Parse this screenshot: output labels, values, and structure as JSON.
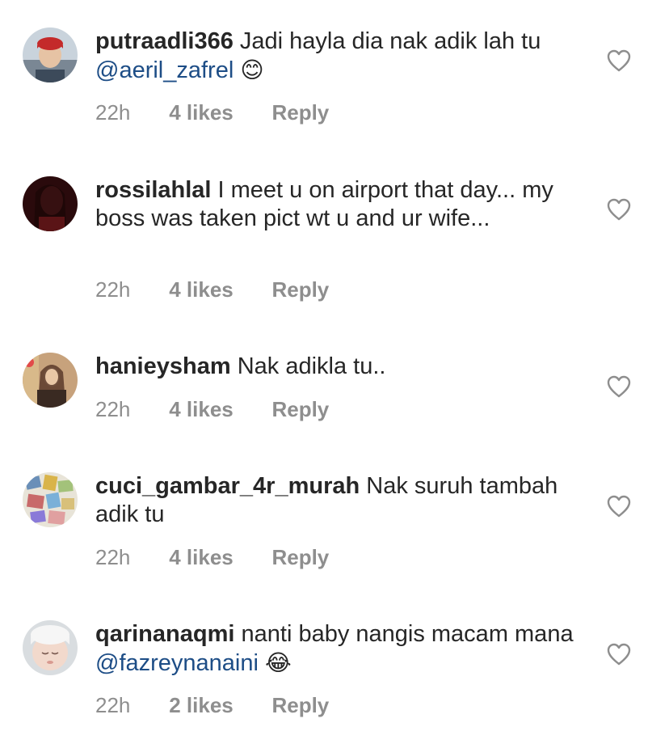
{
  "comments": [
    {
      "username": "putraadli366",
      "text_before": "Jadi hayla dia nak adik lah tu",
      "mention": "@aeril_zafrel",
      "emoji": "😊",
      "time": "22h",
      "likes": "4 likes",
      "reply": "Reply"
    },
    {
      "username": "rossilahlal",
      "text_before": "I meet u on airport that day... my boss was taken pict wt u and ur wife...",
      "mention": "",
      "emoji": "",
      "time": "22h",
      "likes": "4 likes",
      "reply": "Reply"
    },
    {
      "username": "hanieysham",
      "text_before": "Nak adikla tu..",
      "mention": "",
      "emoji": "",
      "time": "22h",
      "likes": "4 likes",
      "reply": "Reply"
    },
    {
      "username": "cuci_gambar_4r_murah",
      "text_before": "Nak suruh tambah adik tu",
      "mention": "",
      "emoji": "",
      "time": "22h",
      "likes": "4 likes",
      "reply": "Reply"
    },
    {
      "username": "qarinanaqmi",
      "text_before": "nanti baby nangis macam mana",
      "mention": "@fazreynanaini",
      "emoji": "😂",
      "time": "22h",
      "likes": "2 likes",
      "reply": "Reply"
    }
  ],
  "colors": {
    "text": "#262626",
    "secondary": "#8e8e8e",
    "mention": "#1d4d86",
    "heart_stroke": "#8e8e8e"
  },
  "icons": [
    "heart-outline-icon"
  ]
}
